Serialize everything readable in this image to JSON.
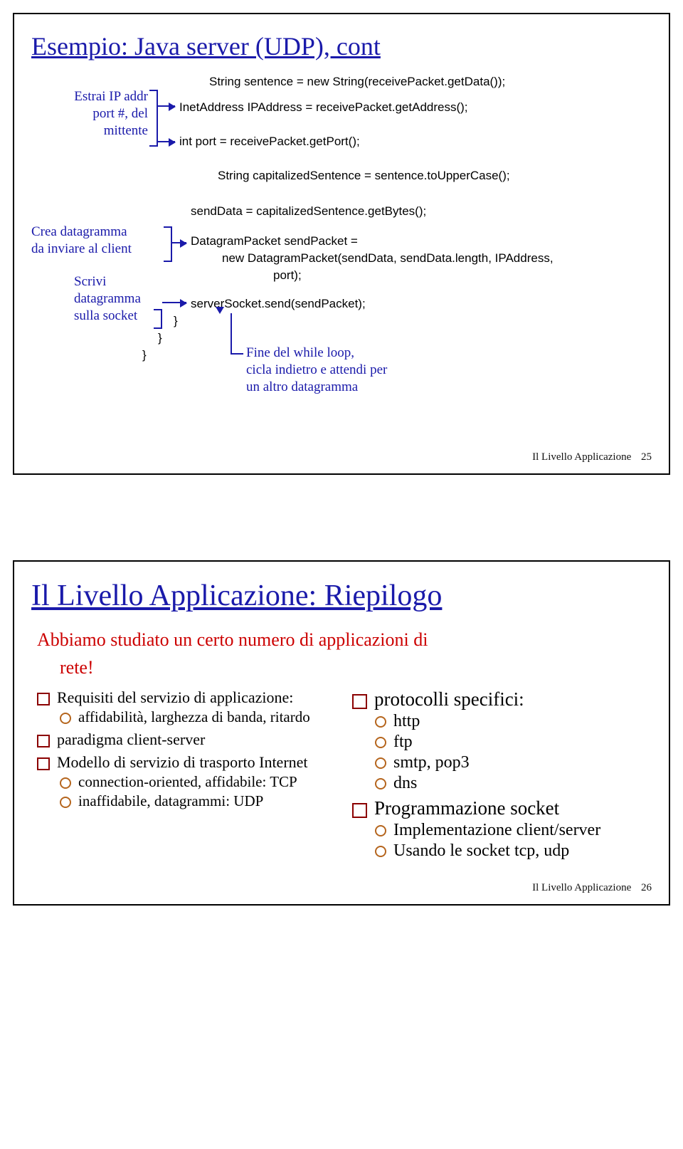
{
  "slide1": {
    "title": "Esempio: Java server (UDP), cont",
    "ann_extract": "Estrai IP addr\nport #, del\nmittente",
    "ann_create": "Crea datagramma\nda inviare al client",
    "ann_write": "Scrivi\ndatagramma\nsulla socket",
    "ann_loop": "Fine del while loop,\ncicla indietro e attendi per\nun altro datagramma",
    "code_top1": "String sentence = new String(receivePacket.getData());",
    "code_top2": "InetAddress IPAddress = receivePacket.getAddress();",
    "code_top3": "int port = receivePacket.getPort();",
    "code_cap": "String capitalizedSentence = sentence.toUpperCase();",
    "code_sd": "sendData = capitalizedSentence.getBytes();",
    "code_dp1": "DatagramPacket sendPacket =",
    "code_dp2": "new DatagramPacket(sendData, sendData.length, IPAddress,",
    "code_dp3": "port);",
    "code_send": "serverSocket.send(sendPacket);",
    "brace1": "}",
    "brace2": "}",
    "brace3": "}",
    "footer": "Il Livello Applicazione",
    "page": "25"
  },
  "slide2": {
    "title": "Il Livello Applicazione: Riepilogo",
    "red1": "Abbiamo studiato un certo numero di applicazioni di",
    "red2": "rete!",
    "left": {
      "b1a": "Requisiti del servizio di applicazione:",
      "b2a": "affidabilità, larghezza di banda, ritardo",
      "b1b": "paradigma client-server",
      "b1c": "Modello di servizio di trasporto Internet",
      "b2b": "connection-oriented, affidabile: TCP",
      "b2c": "inaffidabile, datagrammi: UDP"
    },
    "right": {
      "b1a": "protocolli specifici:",
      "b2a": "http",
      "b2b": "ftp",
      "b2c": "smtp, pop3",
      "b2d": "dns",
      "b1b": "Programmazione socket",
      "b2e": "Implementazione client/server",
      "b2f": "Usando le socket tcp, udp"
    },
    "footer": "Il Livello Applicazione",
    "page": "26"
  }
}
